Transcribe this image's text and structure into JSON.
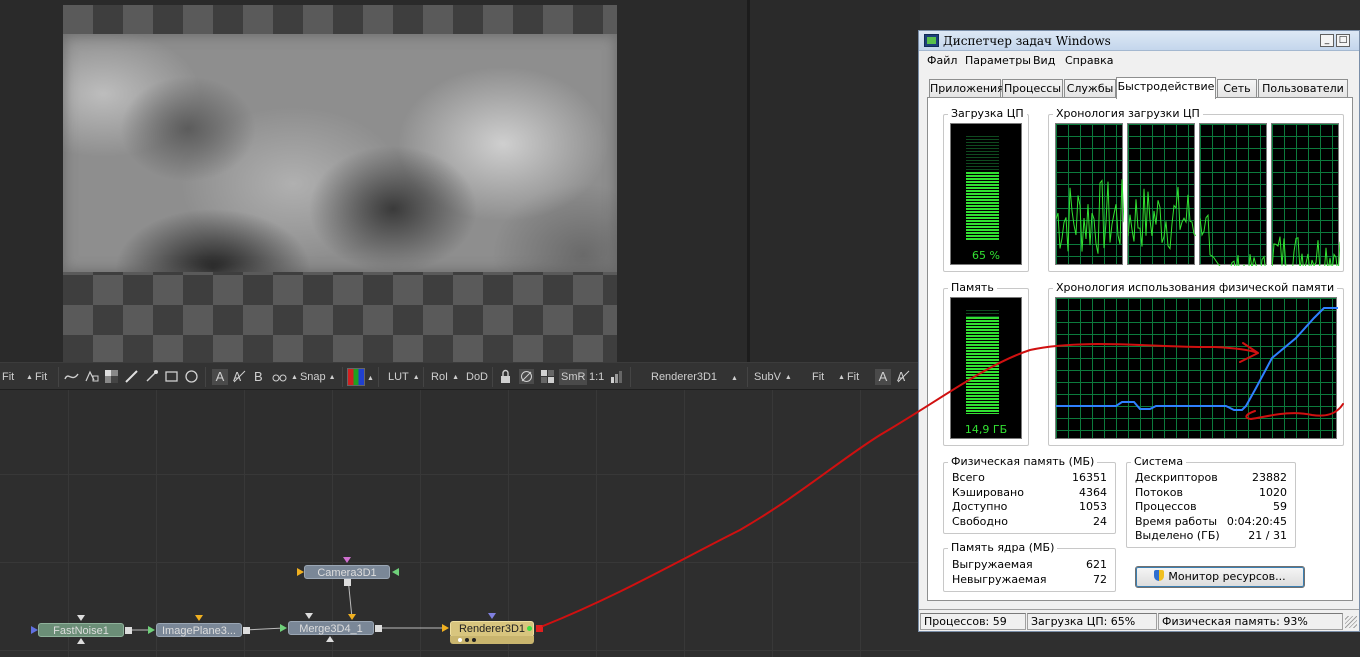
{
  "viewer_toolbar": {
    "fit_a": "Fit",
    "fit_b": "Fit",
    "text_a": "A",
    "text_b": "B",
    "snap": "Snap",
    "lut": "LUT",
    "roi": "RoI",
    "dod": "DoD",
    "smr": "SmR",
    "one_to_one": "1:1",
    "viewing_node": "Renderer3D1",
    "subv": "SubV",
    "fit_c": "Fit",
    "fit_d": "Fit",
    "text_c": "A"
  },
  "flow": {
    "nodes": {
      "camera": "Camera3D1",
      "fastnoise": "FastNoise1",
      "imageplane": "ImagePlane3...",
      "merge": "Merge3D4_1",
      "renderer": "Renderer3D1"
    }
  },
  "taskmgr": {
    "title": "Диспетчер задач Windows",
    "menu": [
      "Файл",
      "Параметры",
      "Вид",
      "Справка"
    ],
    "tabs": [
      "Приложения",
      "Процессы",
      "Службы",
      "Быстродействие",
      "Сеть",
      "Пользователи"
    ],
    "active_tab": "Быстродействие",
    "cpu_usage_label": "Загрузка ЦП",
    "cpu_usage_value": "65 %",
    "cpu_usage_percent": 65,
    "cpu_history_label": "Хронология загрузки ЦП",
    "memory_label": "Память",
    "memory_value": "14,9 ГБ",
    "memory_percent": 93,
    "memory_history_label": "Хронология использования физической памяти",
    "physical_memory": {
      "title": "Физическая память (МБ)",
      "rows": [
        {
          "key": "Всего",
          "value": "16351"
        },
        {
          "key": "Кэшировано",
          "value": "4364"
        },
        {
          "key": "Доступно",
          "value": "1053"
        },
        {
          "key": "Свободно",
          "value": "24"
        }
      ]
    },
    "kernel_memory": {
      "title": "Память ядра (МБ)",
      "rows": [
        {
          "key": "Выгружаемая",
          "value": "621"
        },
        {
          "key": "Невыгружаемая",
          "value": "72"
        }
      ]
    },
    "system": {
      "title": "Система",
      "rows": [
        {
          "key": "Дескрипторов",
          "value": "23882"
        },
        {
          "key": "Потоков",
          "value": "1020"
        },
        {
          "key": "Процессов",
          "value": "59"
        },
        {
          "key": "Время работы",
          "value": "0:04:20:45"
        },
        {
          "key": "Выделено (ГБ)",
          "value": "21 / 31"
        }
      ]
    },
    "resource_monitor_button": "Монитор ресурсов...",
    "status": {
      "processes": "Процессов: 59",
      "cpu": "Загрузка ЦП: 65%",
      "memory": "Физическая память: 93%"
    }
  },
  "colors": {
    "meter_green": "#32e132",
    "graph_grid": "#0c7a3c",
    "memory_line": "#2f80ff",
    "annotation_red": "#d01010",
    "renderer_node": "#d8c57e"
  }
}
